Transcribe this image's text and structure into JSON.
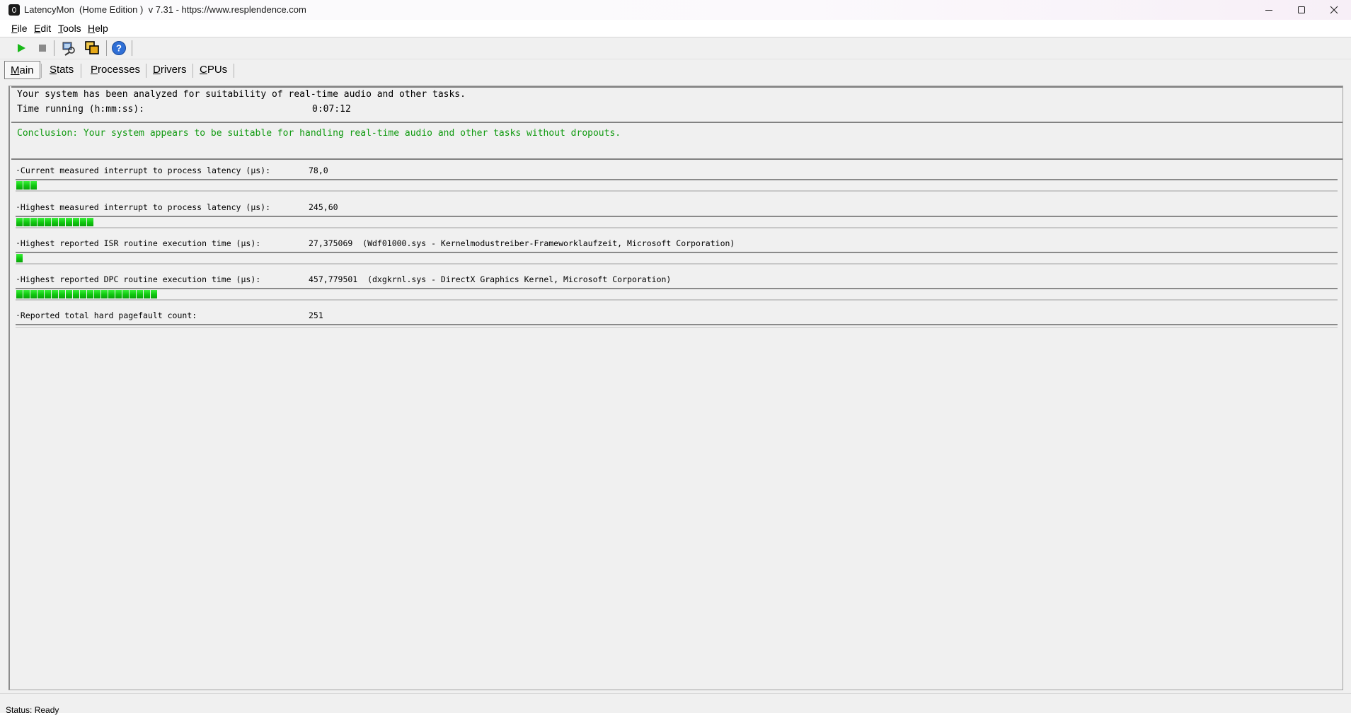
{
  "window": {
    "title": "LatencyMon  (Home Edition )  v 7.31 - https://www.resplendence.com"
  },
  "menu": {
    "items": [
      "File",
      "Edit",
      "Tools",
      "Help"
    ]
  },
  "toolbar": {
    "icons": [
      "play-icon",
      "stop-icon",
      "system-info-icon",
      "windows-icon",
      "help-icon"
    ]
  },
  "tabs": {
    "items": [
      "Main",
      "Stats",
      "Processes",
      "Drivers",
      "CPUs"
    ],
    "active": "Main"
  },
  "summary": {
    "analysis_text": "Your system has been analyzed for suitability of real-time audio and other tasks.",
    "time_running_label": "Time running (h:mm:ss):",
    "time_running_value": "0:07:12",
    "conclusion": "Conclusion: Your system appears to be suitable for handling real-time audio and other tasks without dropouts."
  },
  "metrics": [
    {
      "label": "·Current measured interrupt to process latency (µs):",
      "value": "78,0",
      "bar_segments": 3
    },
    {
      "label": "·Highest measured interrupt to process latency (µs):",
      "value": "245,60",
      "bar_segments": 11
    },
    {
      "label": "·Highest reported ISR routine execution time (µs):",
      "value": "27,375069  (Wdf01000.sys - Kernelmodustreiber-Frameworklaufzeit, Microsoft Corporation)",
      "bar_segments": 1
    },
    {
      "label": "·Highest reported DPC routine execution time (µs):",
      "value": "457,779501  (dxgkrnl.sys - DirectX Graphics Kernel, Microsoft Corporation)",
      "bar_segments": 20
    },
    {
      "label": "·Reported total hard pagefault count:",
      "value": "251",
      "bar_segments": 0
    }
  ],
  "status": {
    "text": "Status: Ready"
  },
  "colors": {
    "conclusion_green": "#109a10",
    "bar_green": "#0fc70f",
    "background": "#f0f0f0"
  }
}
